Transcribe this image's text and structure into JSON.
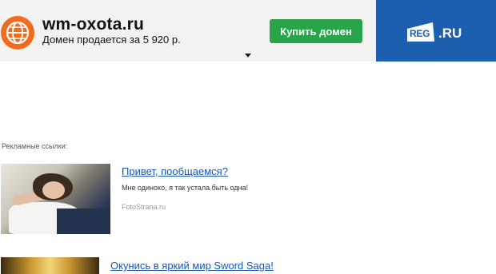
{
  "header": {
    "domain_name": "wm-oxota.ru",
    "price_text": "Домен продается за 5 920 р.",
    "buy_button_label": "Купить домен",
    "globe_icon": "globe-icon",
    "dropdown_icon": "caret-down-icon"
  },
  "registrar": {
    "logo_house_text": "REG",
    "logo_suffix_text": ".RU",
    "brand_color": "#1b5fae"
  },
  "ads": {
    "label": "Рекламные ссылки:",
    "items": [
      {
        "title": "Привет, пообщаемся?",
        "description": "Мне одиноко, я так устала быть одна!",
        "source": "FotoStrana.ru"
      },
      {
        "title": "Окунись в яркий мир Sword Saga!"
      }
    ]
  },
  "colors": {
    "topbar_bg": "#f2f2f2",
    "accent_orange": "#f26a1b",
    "buy_button_green": "#2aa44a",
    "link_blue": "#1a56b0"
  }
}
